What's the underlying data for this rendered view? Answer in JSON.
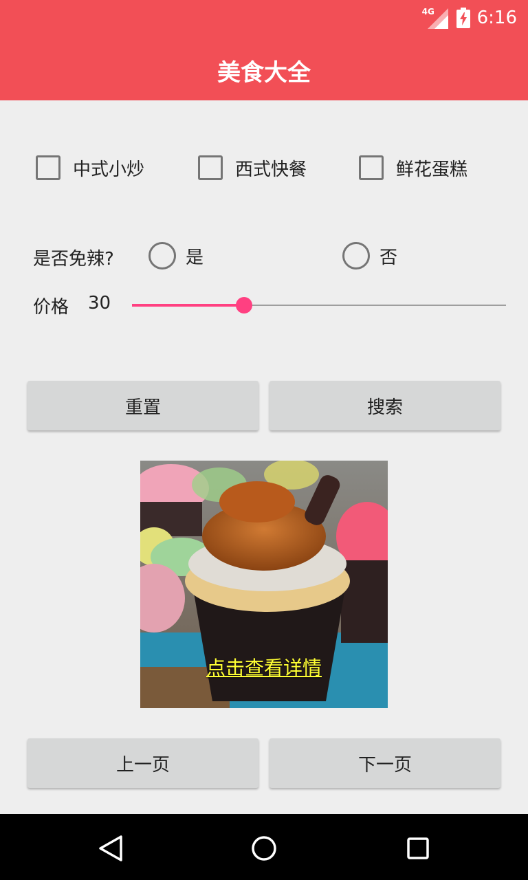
{
  "status_bar": {
    "network": "4G",
    "time": "6:16"
  },
  "app_bar": {
    "title": "美食大全"
  },
  "filters": {
    "categories": [
      {
        "label": "中式小炒",
        "checked": false
      },
      {
        "label": "西式快餐",
        "checked": false
      },
      {
        "label": "鲜花蛋糕",
        "checked": false
      }
    ],
    "spicy": {
      "question": "是否免辣?",
      "options": [
        {
          "label": "是",
          "selected": false
        },
        {
          "label": "否",
          "selected": false
        }
      ]
    },
    "price": {
      "label": "价格",
      "value": "30",
      "slider_fraction": 0.3
    }
  },
  "actions": {
    "reset_label": "重置",
    "search_label": "搜索"
  },
  "result": {
    "image": "cupcake-photo",
    "detail_link": "点击查看详情"
  },
  "pagination": {
    "prev_label": "上一页",
    "next_label": "下一页"
  },
  "nav_bar": {
    "icons": [
      "back-icon",
      "home-icon",
      "recents-icon"
    ]
  },
  "colors": {
    "primary": "#f24f56",
    "accent": "#ff4081",
    "link": "#ffff33"
  }
}
